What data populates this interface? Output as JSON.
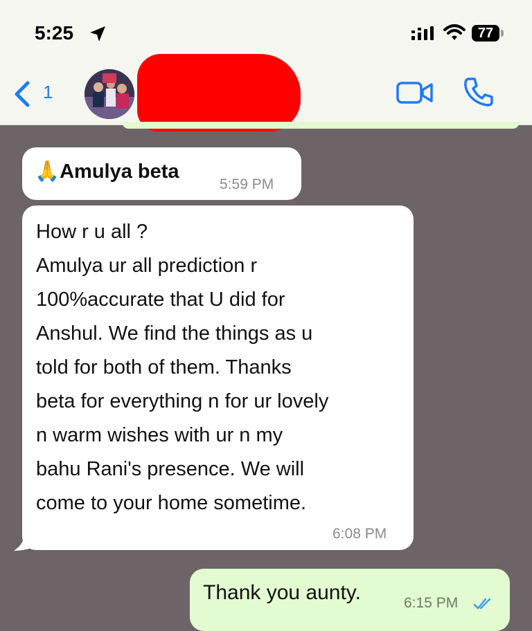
{
  "status_bar": {
    "time": "5:25",
    "battery": "77"
  },
  "header": {
    "back_count": "1"
  },
  "messages": [
    {
      "text": "Amulya beta",
      "emoji": "🙏",
      "time": "5:59 PM"
    },
    {
      "text": "How r u all ?\nAmulya ur all prediction r\n100%accurate that U did for\nAnshul.  We find the things as u\ntold for both of them. Thanks\nbeta for everything n for ur lovely\nn warm wishes  with ur  n my\nbahu Rani's presence. We will\ncome to your home  sometime.",
      "time": "6:08 PM"
    },
    {
      "text": "Thank you aunty.",
      "time": "6:15 PM"
    }
  ],
  "colors": {
    "accent": "#1d7bf5",
    "chat_bg": "#6d6467",
    "outgoing": "#e2fbd0",
    "redaction": "#ff0000"
  }
}
